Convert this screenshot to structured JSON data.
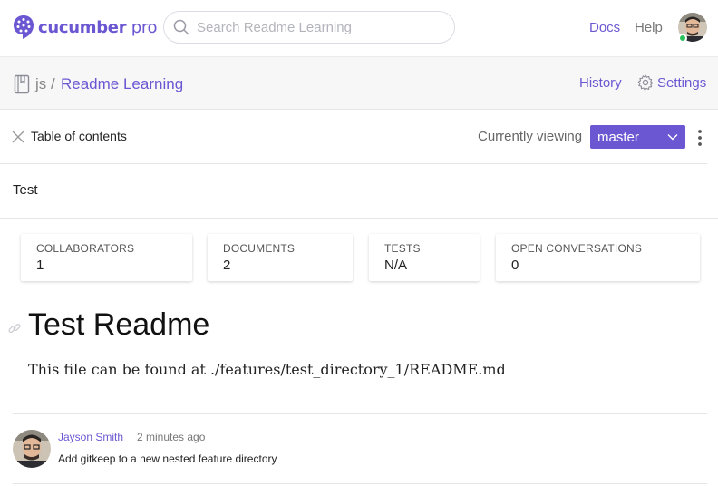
{
  "brand": {
    "name": "cucumber",
    "suffix": " pro",
    "color": "#6b57d2"
  },
  "search": {
    "placeholder": "Search Readme Learning",
    "value": ""
  },
  "nav": {
    "docs": "Docs",
    "help": "Help"
  },
  "repo": {
    "owner": "js /",
    "name": "Readme Learning",
    "history": "History",
    "settings": "Settings"
  },
  "toc": {
    "label": "Table of contents",
    "viewing_label": "Currently viewing",
    "branch": "master"
  },
  "test_row": {
    "label": "Test"
  },
  "stats": [
    {
      "label": "COLLABORATORS",
      "value": "1"
    },
    {
      "label": "DOCUMENTS",
      "value": "2"
    },
    {
      "label": "TESTS",
      "value": "N/A"
    },
    {
      "label": "OPEN CONVERSATIONS",
      "value": "0"
    }
  ],
  "readme": {
    "title": "Test Readme",
    "body": "This file can be found at ./features/test_directory_1/README.md"
  },
  "commit": {
    "author": "Jayson Smith",
    "time": "2 minutes ago",
    "message": "Add gitkeep to a new nested feature directory"
  },
  "icons": {
    "logo": "cucumber-logo-icon",
    "search": "search-icon",
    "repo": "book-icon",
    "settings": "gear-icon",
    "close": "close-icon",
    "dropdown": "chevron-down-icon",
    "more": "kebab-menu-icon",
    "anchor": "link-icon"
  },
  "colors": {
    "accent": "#6b57d2",
    "online": "#2bc25b"
  }
}
